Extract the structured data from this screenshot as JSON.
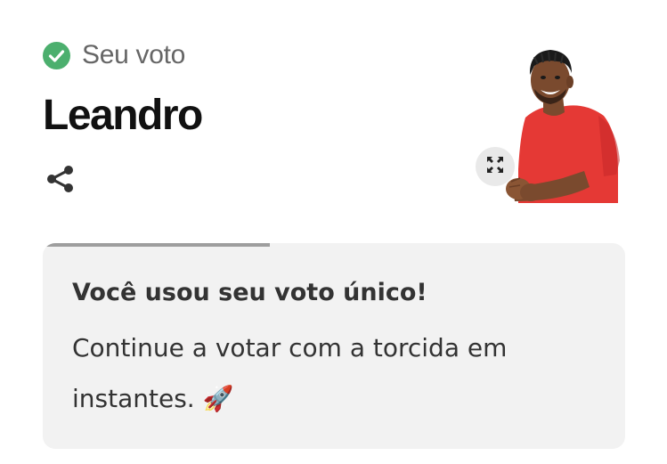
{
  "vote_status": {
    "label": "Seu voto",
    "icon": "check-circle-icon",
    "icon_color": "#4caf6e"
  },
  "candidate": {
    "name": "Leandro",
    "shirt_color": "#e53935"
  },
  "actions": {
    "share_icon": "share-icon",
    "expand_icon": "expand-icon"
  },
  "notice": {
    "progress": 0.39,
    "title": "Você usou seu voto único!",
    "body": "Continue a votar com a torcida em instantes. 🚀",
    "accent": "#9e9e9e",
    "background": "#f2f2f2"
  }
}
